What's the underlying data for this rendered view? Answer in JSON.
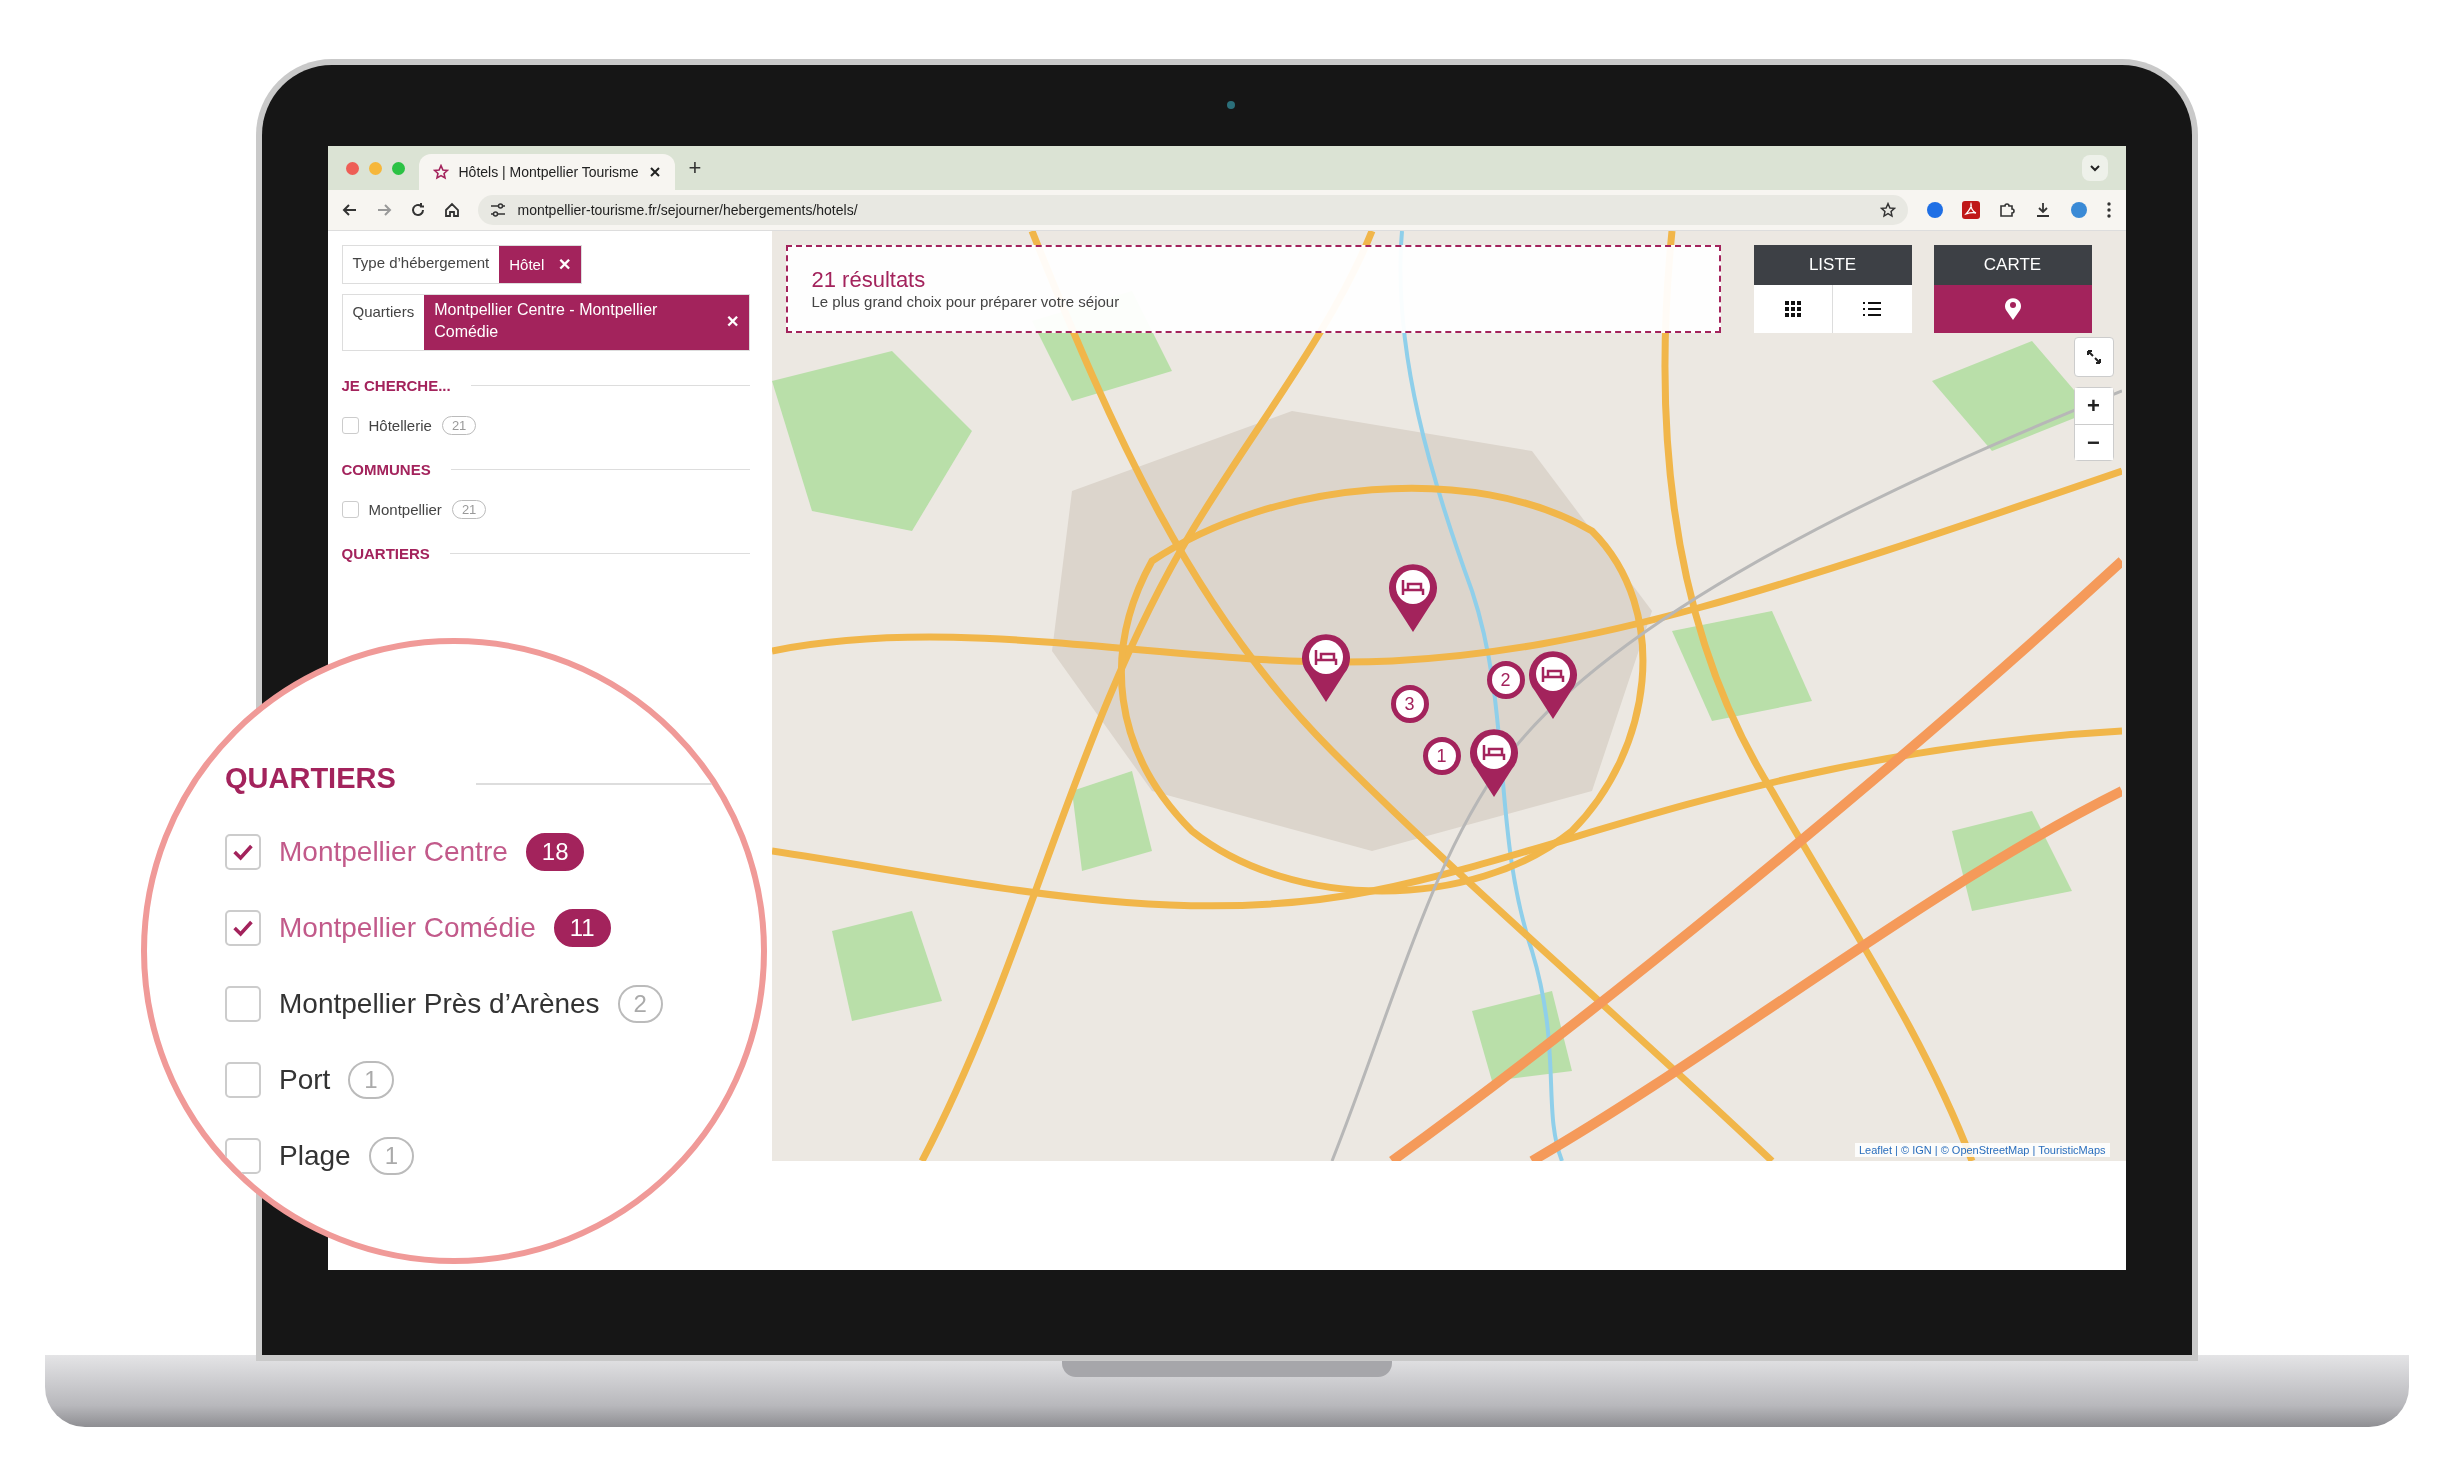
{
  "browser": {
    "tab_title": "Hôtels | Montpellier Tourisme",
    "new_tab": "+",
    "url": "montpellier-tourisme.fr/sejourner/hebergements/hotels/"
  },
  "active_filters": [
    {
      "label": "Type d’hébergement",
      "value": "Hôtel",
      "remove": "✕"
    },
    {
      "label": "Quartiers",
      "value": "Montpellier Centre - Montpellier Comédie",
      "remove": "✕"
    }
  ],
  "sections": [
    {
      "title": "JE CHERCHE...",
      "options": [
        {
          "label": "Hôtellerie",
          "count": "21",
          "checked": false
        }
      ]
    },
    {
      "title": "COMMUNES",
      "options": [
        {
          "label": "Montpellier",
          "count": "21",
          "checked": false
        }
      ]
    },
    {
      "title": "QUARTIERS"
    }
  ],
  "magnifier": {
    "title": "QUARTIERS",
    "options": [
      {
        "label": "Montpellier Centre",
        "count": "18",
        "checked": true
      },
      {
        "label": "Montpellier Comédie",
        "count": "11",
        "checked": true
      },
      {
        "label": "Montpellier Près d’Arènes",
        "count": "2",
        "checked": false
      },
      {
        "label": "Port",
        "count": "1",
        "checked": false
      },
      {
        "label": "Plage",
        "count": "1",
        "checked": false
      }
    ]
  },
  "map": {
    "results_title": "21 résultats",
    "results_subtitle": "Le plus grand choix pour préparer votre séjour",
    "views": [
      {
        "label": "LISTE",
        "selected": false
      },
      {
        "label": "CARTE",
        "selected": true
      }
    ],
    "markers": [
      {
        "kind": "pin"
      },
      {
        "kind": "pin"
      },
      {
        "kind": "cluster",
        "label": "3"
      },
      {
        "kind": "cluster",
        "label": "2"
      },
      {
        "kind": "pin"
      },
      {
        "kind": "cluster",
        "label": "1"
      },
      {
        "kind": "pin"
      }
    ],
    "zoom_in": "+",
    "zoom_out": "−",
    "attribution": "Leaflet | © IGN | © OpenStreetMap | TouristicMaps"
  }
}
